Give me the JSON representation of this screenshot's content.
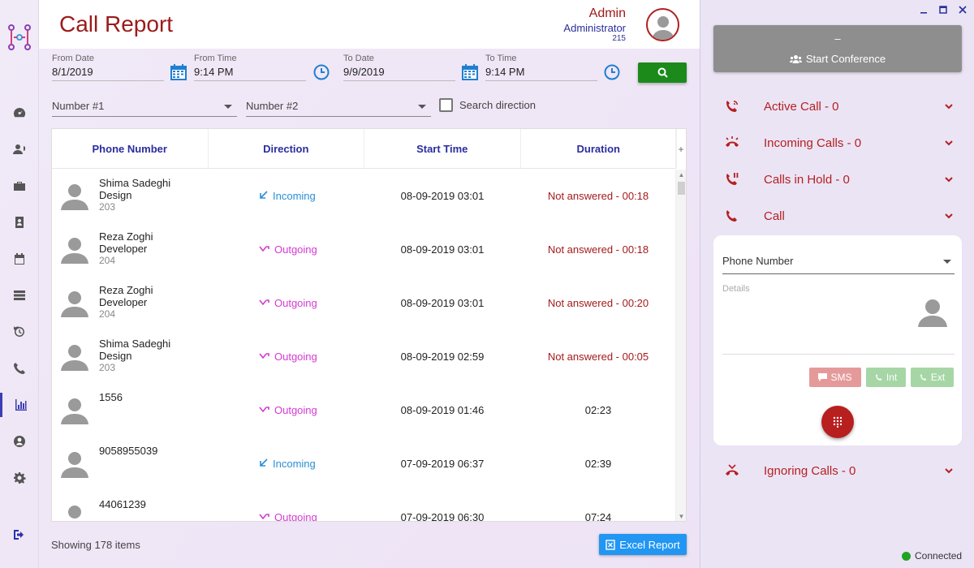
{
  "header": {
    "title": "Call Report",
    "user_name": "Admin",
    "user_role": "Administrator",
    "user_ext": "215"
  },
  "filters": {
    "from_date_label": "From Date",
    "from_date": "8/1/2019",
    "from_time_label": "From Time",
    "from_time": "9:14 PM",
    "to_date_label": "To Date",
    "to_date": "9/9/2019",
    "to_time_label": "To Time",
    "to_time": "9:14 PM",
    "number1_placeholder": "Number #1",
    "number2_placeholder": "Number #2",
    "search_direction_label": "Search direction"
  },
  "table": {
    "columns": [
      "Phone Number",
      "Direction",
      "Start Time",
      "Duration"
    ],
    "rows": [
      {
        "name": "Shima Sadeghi",
        "role": "Design",
        "ext": "203",
        "direction": "Incoming",
        "start": "08-09-2019 03:01",
        "duration": "Not answered - 00:18",
        "missed": true
      },
      {
        "name": "Reza Zoghi",
        "role": "Developer",
        "ext": "204",
        "direction": "Outgoing",
        "start": "08-09-2019 03:01",
        "duration": "Not answered - 00:18",
        "missed": true
      },
      {
        "name": "Reza Zoghi",
        "role": "Developer",
        "ext": "204",
        "direction": "Outgoing",
        "start": "08-09-2019 03:01",
        "duration": "Not answered - 00:20",
        "missed": true
      },
      {
        "name": "Shima Sadeghi",
        "role": "Design",
        "ext": "203",
        "direction": "Outgoing",
        "start": "08-09-2019 02:59",
        "duration": "Not answered - 00:05",
        "missed": true
      },
      {
        "name": "1556",
        "role": "",
        "ext": "",
        "direction": "Outgoing",
        "start": "08-09-2019 01:46",
        "duration": "02:23",
        "missed": false
      },
      {
        "name": "9058955039",
        "role": "",
        "ext": "",
        "direction": "Incoming",
        "start": "07-09-2019 06:37",
        "duration": "02:39",
        "missed": false
      },
      {
        "name": "44061239",
        "role": "",
        "ext": "",
        "direction": "Outgoing",
        "start": "07-09-2019 06:30",
        "duration": "07:24",
        "missed": false
      }
    ]
  },
  "footer": {
    "count_text": "Showing 178 items",
    "excel_label": "Excel Report"
  },
  "panel": {
    "conference_dash": "–",
    "conference_label": "Start Conference",
    "sections": {
      "active": "Active Call - 0",
      "incoming": "Incoming Calls - 0",
      "hold": "Calls in Hold - 0",
      "call": "Call",
      "ignoring": "Ignoring Calls - 0"
    },
    "phone_number_placeholder": "Phone Number",
    "details_label": "Details",
    "sms_label": "SMS",
    "int_label": "Int",
    "ext_label": "Ext",
    "status": "Connected"
  },
  "colors": {
    "brand_red": "#b51f1f",
    "accent_blue": "#2a2d9e",
    "incoming": "#2a8fd6",
    "outgoing": "#d43bd0",
    "search_green": "#1b8a1b",
    "excel_blue": "#2196f3"
  },
  "icons": {
    "sidebar": [
      "dashboard-icon",
      "contacts-icon",
      "briefcase-icon",
      "address-book-icon",
      "calendar-icon",
      "server-icon",
      "history-icon",
      "phone-icon",
      "chart-icon",
      "user-icon",
      "settings-icon",
      "logout-icon"
    ]
  }
}
